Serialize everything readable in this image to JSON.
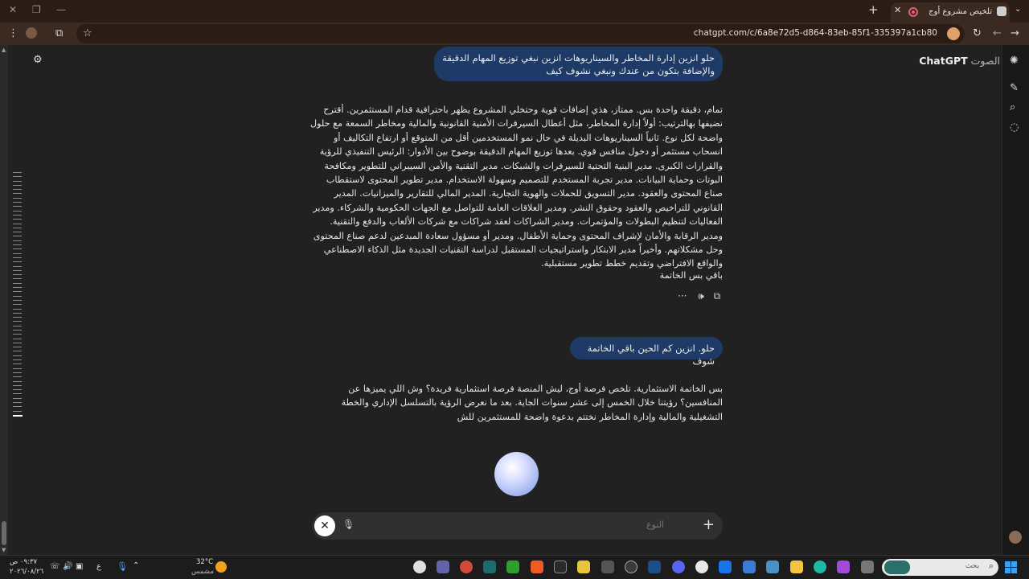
{
  "browser": {
    "tab_title": "تلخيص مشروع أوج",
    "url": "chatgpt.com/c/6a8e72d5-d864-83eb-85f1-335397a1cb80",
    "new_tab": "+",
    "tab_close": "✕",
    "minimize": "—",
    "restore": "❐",
    "close": "✕"
  },
  "app": {
    "brand": "ChatGPT",
    "brand_sub": "الصوت"
  },
  "messages": [
    {
      "role": "user",
      "text": "حلو انزين إدارة المخاطر والسيناريوهات انزين نبغي توزيع المهام الدقيقة والإضافة بتكون من عندك ونبغي نشوف كيف"
    },
    {
      "role": "assistant",
      "text": "تمام، دقيقة واحدة بس. ممتاز، هذي إضافات قوية وحتخلي المشروع يظهر باحترافية قدام المستثمرين. أقترح نضيفها بهالترتيب: أولاً إدارة المخاطر، مثل أعطال السيرفرات الأمنية القانونية والمالية ومخاطر السمعة مع حلول واضحة لكل نوع. ثانياً السيناريوهات البديلة في حال نمو المستخدمين أقل من المتوقع أو ارتفاع التكاليف أو انسحاب مستثمر أو دخول منافس قوي. بعدها توزيع المهام الدقيقة بوضوح بين الأدوار: الرئيس التنفيذي للرؤية والقرارات الكبرى. مدير البنية التحتية للسيرفرات والشبكات. مدير التقنية والأمن السيبراني للتطوير ومكافحة البوتات وحماية البيانات. مدير تجربة المستخدم للتصميم وسهولة الاستخدام. مدير تطوير المحتوى لاستقطاب صناع المحتوى والعقود. مدير التسويق للحملات والهوية التجارية. المدير المالي للتقارير والميزانيات. المدير القانوني للتراخيص والعقود وحقوق النشر. ومدير العلاقات العامة للتواصل مع الجهات الحكومية والشركاء. ومدير الفعاليات لتنظيم البطولات والمؤتمرات. ومدير الشراكات لعقد شراكات مع شركات الألعاب والدفع والتقنية. ومدير الرقابة والأمان لإشراف المحتوى وحماية الأطفال. ومدير أو مسؤول سعادة المبدعين لدعم صناع المحتوى وحل مشكلاتهم. وأخيراً مدير الابتكار واستراتيجيات المستقبل لدراسة التقنيات الجديدة مثل الذكاء الاصطناعي والواقع الافتراضي وتقديم خطط تطوير مستقبلية.",
      "footer": "باقي بس الخاتمة"
    },
    {
      "role": "user",
      "text": "حلو. انزين كم الحين باقي الخاتمة شوف"
    },
    {
      "role": "assistant",
      "text": "بس الخاتمة الاستثمارية. تلخص فرصة أوج، ليش المنصة فرصة استثمارية فريدة؟ وش اللي يميزها عن المنافسين؟ رؤيتنا خلال الخمس إلى عشر سنوات الجاية. بعد ما نعرض الرؤية بالتسلسل الإداري والخطة التشغيلية والمالية وإدارة المخاطر نختتم بدعوة واضحة للمستثمرين للش"
    }
  ],
  "actions": {
    "copy": "⧉",
    "read_aloud": "🕪",
    "more": "···"
  },
  "composer": {
    "placeholder": "النوع",
    "close": "✕",
    "mic_off": "🎙",
    "plus": "+"
  },
  "taskbar": {
    "search_placeholder": "بحث",
    "weather_temp": "32°C",
    "weather_desc": "مشمس",
    "time": "٠٩:٣٧ ص",
    "date": "٢٠٢٦/٠٨/٢٦",
    "lang": "ع"
  }
}
